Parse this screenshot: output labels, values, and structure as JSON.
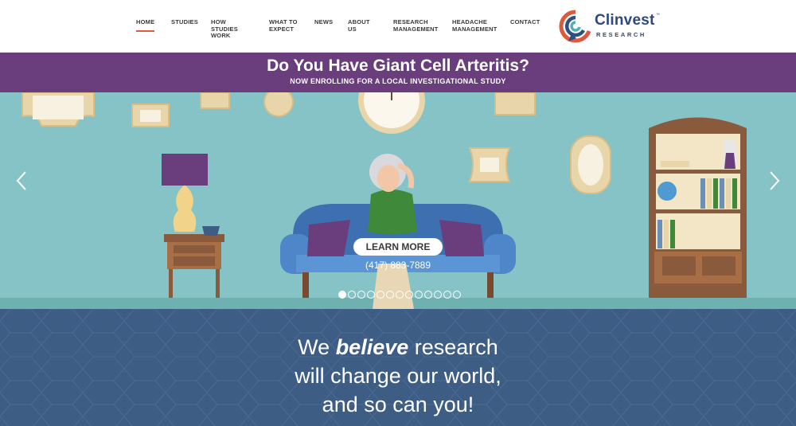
{
  "nav": {
    "items": [
      {
        "label": "HOME",
        "active": true
      },
      {
        "label": "STUDIES"
      },
      {
        "label": "HOW STUDIES WORK"
      },
      {
        "label": "WHAT TO EXPECT"
      },
      {
        "label": "NEWS"
      },
      {
        "label": "ABOUT US"
      },
      {
        "label": "RESEARCH MANAGEMENT"
      },
      {
        "label": "HEADACHE MANAGEMENT"
      },
      {
        "label": "CONTACT"
      }
    ],
    "active_underline_color": "#e25a3e"
  },
  "logo": {
    "wordmark": "Clinvest",
    "subtitle": "RESEARCH",
    "trademark": "™"
  },
  "banner": {
    "title": "Do You Have Giant Cell Arteritis?",
    "subtitle": "NOW ENROLLING FOR A LOCAL INVESTIGATIONAL STUDY",
    "color": "#6a3d7c"
  },
  "hero": {
    "cta_label": "LEARN MORE",
    "phone": "(417) 883-7889",
    "slide_count": 13,
    "active_slide": 1,
    "prev_icon": "chevron-left-icon",
    "next_icon": "chevron-right-icon",
    "background_color": "#86c3c6"
  },
  "belief": {
    "line1_prefix": "We ",
    "line1_emphasis": "believe",
    "line1_suffix": " research",
    "line2": "will change our world,",
    "line3": "and so can you!",
    "background_color": "#3e5d84"
  }
}
